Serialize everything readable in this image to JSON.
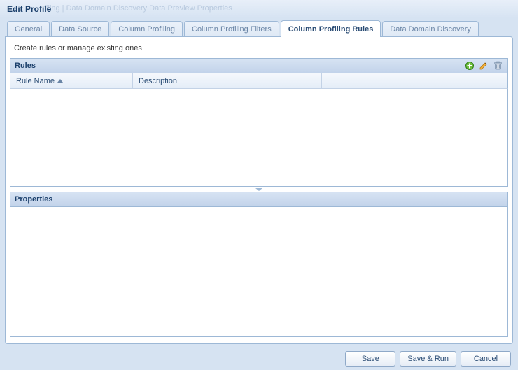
{
  "titlebar": {
    "title": "Edit Profile",
    "ghost_text": "filing | Data Domain Discovery   Data Preview   Properties"
  },
  "tabs": [
    {
      "label": "General",
      "active": false
    },
    {
      "label": "Data Source",
      "active": false
    },
    {
      "label": "Column Profiling",
      "active": false
    },
    {
      "label": "Column Profiling Filters",
      "active": false
    },
    {
      "label": "Column Profiling Rules",
      "active": true
    },
    {
      "label": "Data Domain Discovery",
      "active": false
    }
  ],
  "instruction": "Create rules or manage existing ones",
  "rules_panel": {
    "title": "Rules",
    "columns": {
      "name": "Rule Name",
      "description": "Description"
    },
    "rows": []
  },
  "properties_panel": {
    "title": "Properties"
  },
  "footer": {
    "save": "Save",
    "save_run": "Save & Run",
    "cancel": "Cancel"
  }
}
